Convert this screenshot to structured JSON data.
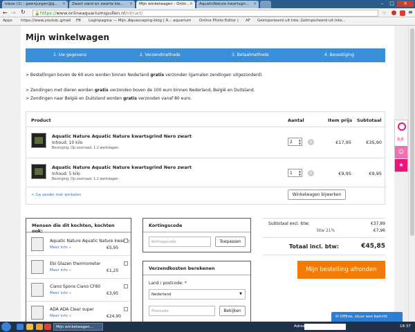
{
  "browser": {
    "tabs": [
      {
        "label": "Inbox (1) - gwenjurgen@g..."
      },
      {
        "label": "Zwart zand en zwarte kie..."
      },
      {
        "label": "Mijn winkelwagen - Onlin..."
      },
      {
        "label": "AquaticNature kwartsgri..."
      }
    ],
    "url_scheme": "https://",
    "url_host": "www.onlineaquariumspullen.nl",
    "url_path": "/nl/cart/",
    "bookmarks": [
      "Apps",
      "https://www.youtub...",
      "gmail",
      "FB",
      "Loginpagina — Mijn...",
      "Aquascaping-blog | A...",
      "aquarium",
      "Online Photo Editor |",
      "AF",
      "Geïmporteerd uit Inte...",
      "Geïmporteerd uit Inte..."
    ]
  },
  "page": {
    "title": "Mijn winkelwagen",
    "steps": [
      "1.  Uw gegevens",
      "2.  Verzendmethode",
      "3.  Betaalmethode",
      "4.  Bevestiging"
    ],
    "notices": [
      {
        "pre": "> Bestellingen boven de 60 euro worden binnen Nederland ",
        "bold": "gratis",
        "post": " verzonden (garnalen zendingen uitgezonderd)."
      },
      {
        "pre": "> Zendingen met dieren worden ",
        "bold": "gratis",
        "post": " verzonden boven de 100 euro binnen Nederland, België en Duitsland."
      },
      {
        "pre": "> Zendingen naar België en Duitsland worden ",
        "bold": "gratis",
        "post": " verzonden vanaf 80 euro."
      }
    ],
    "cart": {
      "headers": {
        "product": "Product",
        "qty": "Aantal",
        "price": "Item prijs",
        "subtotal": "Subtotaal"
      },
      "items": [
        {
          "name": "Aquatic Nature Aquatic Nature kwartsgrind Nero zwart",
          "content": "Inhoud: 10 kilo",
          "shipping": "Bezorging: Op voorraad, 1-2 werkdagen",
          "qty": "2",
          "price": "€17,95",
          "subtotal": "€35,90"
        },
        {
          "name": "Aquatic Nature Aquatic Nature kwartsgrind Nero zwart",
          "content": "Inhoud: 5 kilo",
          "shipping": "Bezorging: Op voorraad, 1-2 werkdagen",
          "qty": "1",
          "price": "€9,95",
          "subtotal": "€9,95"
        }
      ],
      "continue": "< Ga verder met winkelen",
      "update": "Winkelwagen bijwerken"
    },
    "related": {
      "title": "Mensen die dit kochten, kochten ook:",
      "more": "Meer info »",
      "items": [
        {
          "name": "Aquatic Nature Aquatic Nature kwartsgr",
          "price": "€5,95"
        },
        {
          "name": "Ebi Glazen thermometer",
          "price": "€1,25"
        },
        {
          "name": "Ciano Spons Ciano CF80",
          "price": "€3,95"
        },
        {
          "name": "ADA ADA Clear super",
          "price": "€24,90"
        }
      ]
    },
    "coupon": {
      "title": "Kortingscode",
      "placeholder": "Kortingscode",
      "apply": "Toepassen"
    },
    "shipping_calc": {
      "title": "Verzendkosten berekenen",
      "country_label": "Land / postcode: *",
      "country": "Nederland",
      "postcode_placeholder": "Postcode",
      "button": "Bekijken"
    },
    "totals": {
      "subtotal_label": "Subtotaal excl. btw:",
      "subtotal": "€37,89",
      "vat_label": "btw 21%",
      "vat": "€7,96",
      "total_label": "Totaal incl. btw:",
      "total": "€45,85"
    },
    "order_button": "Mijn bestelling afronden",
    "widget_score": "9,6",
    "chat": "Offline, stuur een bericht"
  },
  "taskbar": {
    "window": "Mijn winkelwagen...",
    "address_label": "Adres",
    "clock": "18:37"
  },
  "colors": {
    "accent_blue": "#3a8fd9",
    "order_orange": "#f47a06",
    "widget_pink": "#e8157a"
  }
}
